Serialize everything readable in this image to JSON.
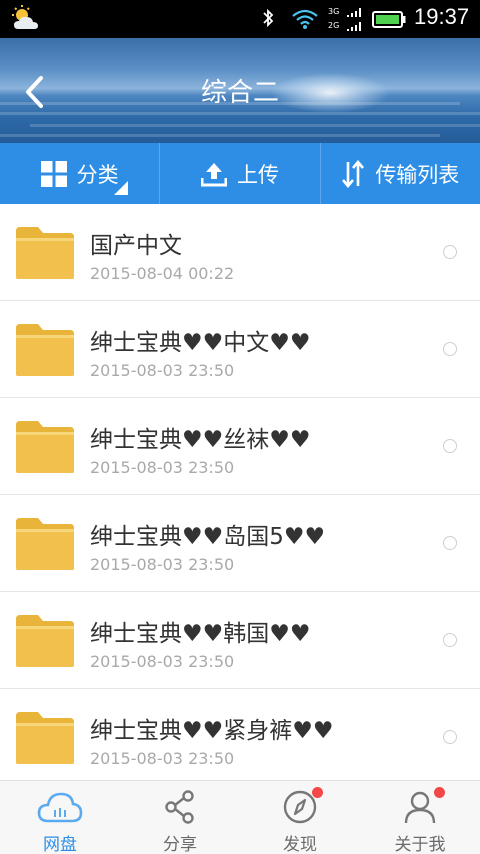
{
  "status_bar": {
    "time": "19:37",
    "signal_label_top": "3G",
    "signal_label_bottom": "2G"
  },
  "header": {
    "title": "综合二"
  },
  "toolbar": {
    "category_label": "分类",
    "upload_label": "上传",
    "transfer_label": "传输列表"
  },
  "files": [
    {
      "name": "国产中文",
      "date": "2015-08-04  00:22"
    },
    {
      "name": "绅士宝典♥♥中文♥♥",
      "date": "2015-08-03  23:50"
    },
    {
      "name": "绅士宝典♥♥丝袜♥♥",
      "date": "2015-08-03  23:50"
    },
    {
      "name": "绅士宝典♥♥岛国5♥♥",
      "date": "2015-08-03  23:50"
    },
    {
      "name": "绅士宝典♥♥韩国♥♥",
      "date": "2015-08-03  23:50"
    },
    {
      "name": "绅士宝典♥♥紧身裤♥♥",
      "date": "2015-08-03  23:50"
    }
  ],
  "bottom_nav": [
    {
      "label": "网盘",
      "icon": "cloud-icon",
      "active": true,
      "badge": false
    },
    {
      "label": "分享",
      "icon": "share-icon",
      "active": false,
      "badge": false
    },
    {
      "label": "发现",
      "icon": "compass-icon",
      "active": false,
      "badge": true
    },
    {
      "label": "关于我",
      "icon": "user-icon",
      "active": false,
      "badge": true
    }
  ],
  "colors": {
    "accent": "#2e8ee6",
    "folder": "#f2c04c",
    "badge": "#f24848"
  }
}
